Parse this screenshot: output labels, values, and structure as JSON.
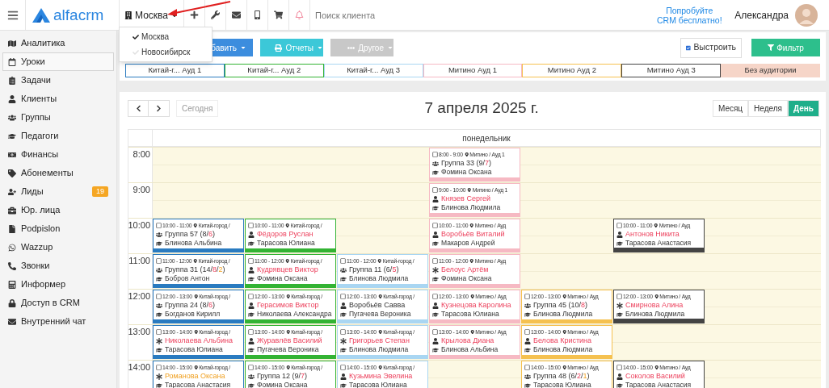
{
  "topbar": {
    "logo": "alfacrm",
    "branch": "Москва",
    "search": {
      "placeholder": "Поиск клиента"
    },
    "promo": "Попробуйте CRM бесплатно!",
    "user": "Александра"
  },
  "branch_menu": {
    "open": true,
    "items": [
      {
        "label": "Москва",
        "checked": true
      },
      {
        "label": "Новосибирск",
        "checked": false
      }
    ]
  },
  "sidebar": {
    "items": [
      {
        "label": "Аналитика",
        "selected": false
      },
      {
        "label": "Уроки",
        "selected": true
      },
      {
        "label": "Задачи",
        "selected": false
      },
      {
        "label": "Клиенты",
        "selected": false
      },
      {
        "label": "Группы",
        "selected": false
      },
      {
        "label": "Педагоги",
        "selected": false
      },
      {
        "label": "Финансы",
        "selected": false
      },
      {
        "label": "Абонементы",
        "selected": false
      },
      {
        "label": "Лиды",
        "selected": false,
        "badge": "19"
      },
      {
        "label": "Юр. лица",
        "selected": false
      },
      {
        "label": "Podpislon",
        "selected": false
      },
      {
        "label": "Wazzup",
        "selected": false
      },
      {
        "label": "Звонки",
        "selected": false
      },
      {
        "label": "Информер",
        "selected": false
      },
      {
        "label": "Доступ в CRM",
        "selected": false
      },
      {
        "label": "Внутренний чат",
        "selected": false
      }
    ]
  },
  "toolbar": {
    "buttons": [
      {
        "label": "бавить",
        "kind": "primary"
      },
      {
        "label": "Отчеты",
        "kind": "info"
      },
      {
        "label": "Другое",
        "kind": "muted"
      }
    ],
    "arrange": {
      "label": "Выстроить",
      "checked": true
    },
    "filter": "Фильтр"
  },
  "rooms": [
    {
      "label": "Китай-г... Ауд 1",
      "color": "#2a7bc0",
      "kind": "room"
    },
    {
      "label": "Китай-г... Ауд 2",
      "color": "#33b333",
      "kind": "room"
    },
    {
      "label": "Китай-г... Ауд 3",
      "color": "#a9d6f2",
      "kind": "room"
    },
    {
      "label": "Митино Ауд 1",
      "color": "#f6b9c3",
      "kind": "room"
    },
    {
      "label": "Митино Ауд 2",
      "color": "#f5c150",
      "kind": "room"
    },
    {
      "label": "Митино Ауд 3",
      "color": "#444444",
      "kind": "room"
    },
    {
      "label": "Без аудитории",
      "color": "#f6d5c8",
      "kind": "unassigned"
    }
  ],
  "calendar": {
    "today": {
      "label": "Сегодня",
      "disabled": true
    },
    "title": "7 апреля 2025 г.",
    "views": [
      {
        "label": "Месяц",
        "selected": false
      },
      {
        "label": "Неделя",
        "selected": false
      },
      {
        "label": "День",
        "selected": true
      }
    ],
    "day": "понедельник",
    "rows": [
      {
        "time": "8:00",
        "cells": [
          {
            "kind": "free"
          },
          {
            "kind": "free"
          },
          {
            "kind": "free"
          },
          {
            "kind": "lesson",
            "checked": false,
            "time": "8:00 - 9:00",
            "place": "Митино / Ауд 1",
            "subject": {
              "kind": "group",
              "parts": [
                {
                  "text": "Группа 33 (9/",
                  "kind": "plain"
                },
                {
                  "text": "7",
                  "kind": "alert"
                },
                {
                  "text": ")",
                  "kind": "plain"
                }
              ]
            },
            "teacher": "Фомина Оксана"
          },
          {
            "kind": "free"
          },
          {
            "kind": "free"
          },
          {
            "kind": "free"
          }
        ]
      },
      {
        "time": "9:00",
        "cells": [
          {
            "kind": "free"
          },
          {
            "kind": "free"
          },
          {
            "kind": "free"
          },
          {
            "kind": "lesson",
            "checked": false,
            "time": "9:00 - 10:00",
            "place": "Митино / Ауд 1",
            "subject": {
              "kind": "client",
              "parts": [
                {
                  "text": "Князев Сергей",
                  "kind": "alert"
                }
              ]
            },
            "teacher": "Блинова Людмила"
          },
          {
            "kind": "free"
          },
          {
            "kind": "free"
          },
          {
            "kind": "free"
          }
        ]
      },
      {
        "time": "10:00",
        "cells": [
          {
            "kind": "lesson",
            "checked": false,
            "time": "10:00 - 11:00",
            "place": "Китай-город /",
            "subject": {
              "kind": "group",
              "parts": [
                {
                  "text": "Группа 57 (8/",
                  "kind": "plain"
                },
                {
                  "text": "6",
                  "kind": "alert"
                },
                {
                  "text": ")",
                  "kind": "plain"
                }
              ]
            },
            "teacher": "Блинова Альбина"
          },
          {
            "kind": "lesson",
            "checked": false,
            "time": "10:00 - 11:00",
            "place": "Китай-город /",
            "subject": {
              "kind": "client",
              "parts": [
                {
                  "text": "Фёдоров Руслан",
                  "kind": "alert"
                }
              ]
            },
            "teacher": "Тарасова Юлиана"
          },
          {
            "kind": "free"
          },
          {
            "kind": "lesson",
            "checked": false,
            "time": "10:00 - 11:00",
            "place": "Митино / Ауд",
            "subject": {
              "kind": "client",
              "parts": [
                {
                  "text": "Воробьёв Виталий",
                  "kind": "alert"
                }
              ]
            },
            "teacher": "Макаров Андрей"
          },
          {
            "kind": "free"
          },
          {
            "kind": "lesson",
            "checked": false,
            "time": "10:00 - 11:00",
            "place": "Митино / Ауд",
            "subject": {
              "kind": "client",
              "parts": [
                {
                  "text": "Антонов Никита",
                  "kind": "alert"
                }
              ]
            },
            "teacher": "Тарасова Анастасия"
          },
          {
            "kind": "free"
          }
        ]
      },
      {
        "time": "11:00",
        "cells": [
          {
            "kind": "lesson",
            "checked": false,
            "time": "11:00 - 12:00",
            "place": "Китай-город /",
            "subject": {
              "kind": "group",
              "parts": [
                {
                  "text": "Группа 31 (14/",
                  "kind": "plain"
                },
                {
                  "text": "8",
                  "kind": "alert"
                },
                {
                  "text": "/",
                  "kind": "plain"
                },
                {
                  "text": "2",
                  "kind": "warn"
                },
                {
                  "text": ")",
                  "kind": "plain"
                }
              ]
            },
            "teacher": "Бобров Антон"
          },
          {
            "kind": "lesson",
            "checked": false,
            "time": "11:00 - 12:00",
            "place": "Китай-город /",
            "subject": {
              "kind": "client",
              "parts": [
                {
                  "text": "Кудрявцев Виктор",
                  "kind": "alert"
                }
              ]
            },
            "teacher": "Фомина Оксана"
          },
          {
            "kind": "lesson",
            "checked": false,
            "time": "11:00 - 12:00",
            "place": "Китай-город /",
            "subject": {
              "kind": "group",
              "parts": [
                {
                  "text": "Группа 11 (6/",
                  "kind": "plain"
                },
                {
                  "text": "5",
                  "kind": "alert"
                },
                {
                  "text": ")",
                  "kind": "plain"
                }
              ]
            },
            "teacher": "Блинова Людмила"
          },
          {
            "kind": "lesson",
            "checked": false,
            "time": "11:00 - 12:00",
            "place": "Митино / Ауд",
            "subject": {
              "kind": "trial",
              "parts": [
                {
                  "text": "Белоус Артём",
                  "kind": "alert"
                }
              ]
            },
            "teacher": "Фомина Оксана"
          },
          {
            "kind": "free"
          },
          {
            "kind": "free"
          },
          {
            "kind": "free"
          }
        ]
      },
      {
        "time": "12:00",
        "cells": [
          {
            "kind": "lesson",
            "checked": false,
            "time": "12:00 - 13:00",
            "place": "Китай-город /",
            "subject": {
              "kind": "group",
              "parts": [
                {
                  "text": "Группа 24 (8/",
                  "kind": "plain"
                },
                {
                  "text": "6",
                  "kind": "alert"
                },
                {
                  "text": ")",
                  "kind": "plain"
                }
              ]
            },
            "teacher": "Богданов Кирилл"
          },
          {
            "kind": "lesson",
            "checked": false,
            "time": "12:00 - 13:00",
            "place": "Китай-город /",
            "subject": {
              "kind": "client",
              "parts": [
                {
                  "text": "Герасимов Виктор",
                  "kind": "alert"
                }
              ]
            },
            "teacher": "Николаева Александра"
          },
          {
            "kind": "lesson",
            "checked": false,
            "time": "12:00 - 13:00",
            "place": "Китай-город /",
            "subject": {
              "kind": "client",
              "parts": [
                {
                  "text": "Воробьёв Савва",
                  "kind": "plain"
                }
              ]
            },
            "teacher": "Пугачева Вероника"
          },
          {
            "kind": "lesson",
            "checked": false,
            "time": "12:00 - 13:00",
            "place": "Митино / Ауд",
            "subject": {
              "kind": "client",
              "parts": [
                {
                  "text": "Кузнецова Каролина",
                  "kind": "alert"
                }
              ]
            },
            "teacher": "Тарасова Юлиана"
          },
          {
            "kind": "lesson",
            "checked": false,
            "time": "12:00 - 13:00",
            "place": "Митино / Ауд",
            "subject": {
              "kind": "group",
              "parts": [
                {
                  "text": "Группа 45 (10/",
                  "kind": "plain"
                },
                {
                  "text": "8",
                  "kind": "alert"
                },
                {
                  "text": ")",
                  "kind": "plain"
                }
              ]
            },
            "teacher": "Блинова Людмила"
          },
          {
            "kind": "lesson",
            "checked": false,
            "time": "12:00 - 13:00",
            "place": "Митино / Ауд",
            "subject": {
              "kind": "trial",
              "parts": [
                {
                  "text": "Смирнова Алина",
                  "kind": "alert"
                }
              ]
            },
            "teacher": "Блинова Людмила"
          },
          {
            "kind": "free"
          }
        ]
      },
      {
        "time": "13:00",
        "cells": [
          {
            "kind": "lesson",
            "checked": false,
            "time": "13:00 - 14:00",
            "place": "Китай-город /",
            "subject": {
              "kind": "trial",
              "parts": [
                {
                  "text": "Николаева Альбина",
                  "kind": "alert"
                }
              ]
            },
            "teacher": "Тарасова Юлиана"
          },
          {
            "kind": "lesson",
            "checked": false,
            "time": "13:00 - 14:00",
            "place": "Китай-город /",
            "subject": {
              "kind": "client",
              "parts": [
                {
                  "text": "Журавлёв Василий",
                  "kind": "alert"
                }
              ]
            },
            "teacher": "Пугачева Вероника"
          },
          {
            "kind": "lesson",
            "checked": false,
            "time": "13:00 - 14:00",
            "place": "Китай-город /",
            "subject": {
              "kind": "trial",
              "parts": [
                {
                  "text": "Григорьев Степан",
                  "kind": "alert"
                }
              ]
            },
            "teacher": "Блинова Людмила"
          },
          {
            "kind": "lesson",
            "checked": false,
            "time": "13:00 - 14:00",
            "place": "Митино / Ауд",
            "subject": {
              "kind": "client",
              "parts": [
                {
                  "text": "Крылова Диана",
                  "kind": "alert"
                }
              ]
            },
            "teacher": "Блинова Альбина"
          },
          {
            "kind": "lesson",
            "checked": false,
            "time": "13:00 - 14:00",
            "place": "Митино / Ауд",
            "subject": {
              "kind": "client",
              "parts": [
                {
                  "text": "Белова Кристина",
                  "kind": "alert"
                }
              ]
            },
            "teacher": "Блинова Людмила"
          },
          {
            "kind": "free"
          },
          {
            "kind": "free"
          }
        ]
      },
      {
        "time": "14:00",
        "cells": [
          {
            "kind": "lesson",
            "checked": false,
            "time": "14:00 - 15:00",
            "place": "Китай-город /",
            "subject": {
              "kind": "trial",
              "parts": [
                {
                  "text": "Романова Оксана",
                  "kind": "warn"
                }
              ]
            },
            "teacher": "Тарасова Анастасия"
          },
          {
            "kind": "lesson",
            "checked": false,
            "time": "14:00 - 15:00",
            "place": "Китай-город /",
            "subject": {
              "kind": "group",
              "parts": [
                {
                  "text": "Группа 12 (9/",
                  "kind": "plain"
                },
                {
                  "text": "7",
                  "kind": "alert"
                },
                {
                  "text": ")",
                  "kind": "plain"
                }
              ]
            },
            "teacher": "Фомина Оксана"
          },
          {
            "kind": "lesson",
            "checked": false,
            "time": "14:00 - 15:00",
            "place": "Китай-город /",
            "subject": {
              "kind": "client",
              "parts": [
                {
                  "text": "Кузьмина Эвелина",
                  "kind": "alert"
                }
              ]
            },
            "teacher": "Тарасова Юлиана"
          },
          {
            "kind": "free"
          },
          {
            "kind": "lesson",
            "checked": false,
            "time": "14:00 - 15:00",
            "place": "Митино / Ауд",
            "subject": {
              "kind": "group",
              "parts": [
                {
                  "text": "Группа 48 (6/",
                  "kind": "plain"
                },
                {
                  "text": "2",
                  "kind": "alert"
                },
                {
                  "text": "/",
                  "kind": "plain"
                },
                {
                  "text": "1",
                  "kind": "warn"
                },
                {
                  "text": ")",
                  "kind": "plain"
                }
              ]
            },
            "teacher": "Тарасова Юлиана"
          },
          {
            "kind": "lesson",
            "checked": false,
            "time": "14:00 - 15:00",
            "place": "Митино / Ауд",
            "subject": {
              "kind": "client",
              "parts": [
                {
                  "text": "Соколов Василий",
                  "kind": "alert"
                }
              ]
            },
            "teacher": "Тарасова Анастасия"
          },
          {
            "kind": "free"
          }
        ]
      }
    ]
  }
}
